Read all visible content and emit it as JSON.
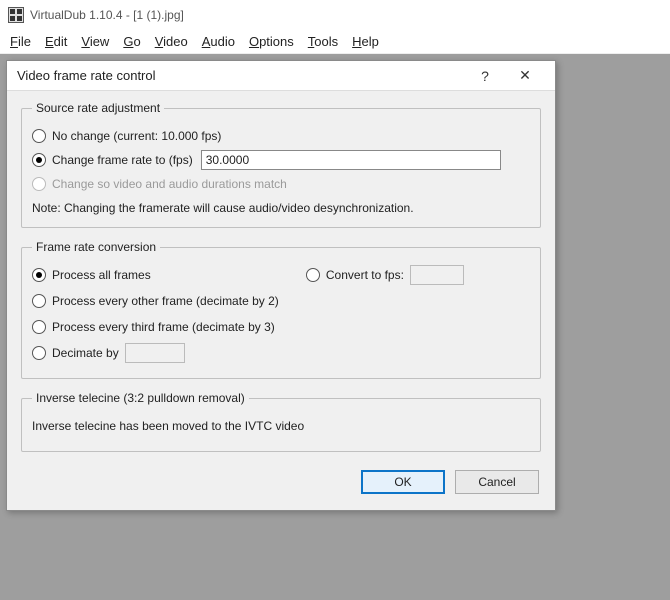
{
  "app": {
    "title": "VirtualDub 1.10.4 - [1 (1).jpg]"
  },
  "menu": {
    "file": "File",
    "edit": "Edit",
    "view": "View",
    "go": "Go",
    "video": "Video",
    "audio": "Audio",
    "options": "Options",
    "tools": "Tools",
    "help": "Help"
  },
  "dialog": {
    "title": "Video frame rate control",
    "help_glyph": "?",
    "close_glyph": "✕",
    "src": {
      "legend": "Source rate adjustment",
      "no_change": "No change (current: 10.000 fps)",
      "change_to": "Change frame rate to (fps)",
      "change_value": "30.0000",
      "match_durations": "Change so video and audio durations match",
      "note": "Note: Changing the framerate will cause audio/video desynchronization."
    },
    "frc": {
      "legend": "Frame rate conversion",
      "all": "Process all frames",
      "every_other": "Process every other frame (decimate by 2)",
      "every_third": "Process every third frame (decimate by 3)",
      "decimate_by": "Decimate by",
      "decimate_value": "",
      "convert_to": "Convert to fps:",
      "convert_value": ""
    },
    "ivt": {
      "legend": "Inverse telecine (3:2 pulldown removal)",
      "body": "Inverse telecine has been moved to the IVTC video"
    },
    "buttons": {
      "ok": "OK",
      "cancel": "Cancel"
    }
  }
}
